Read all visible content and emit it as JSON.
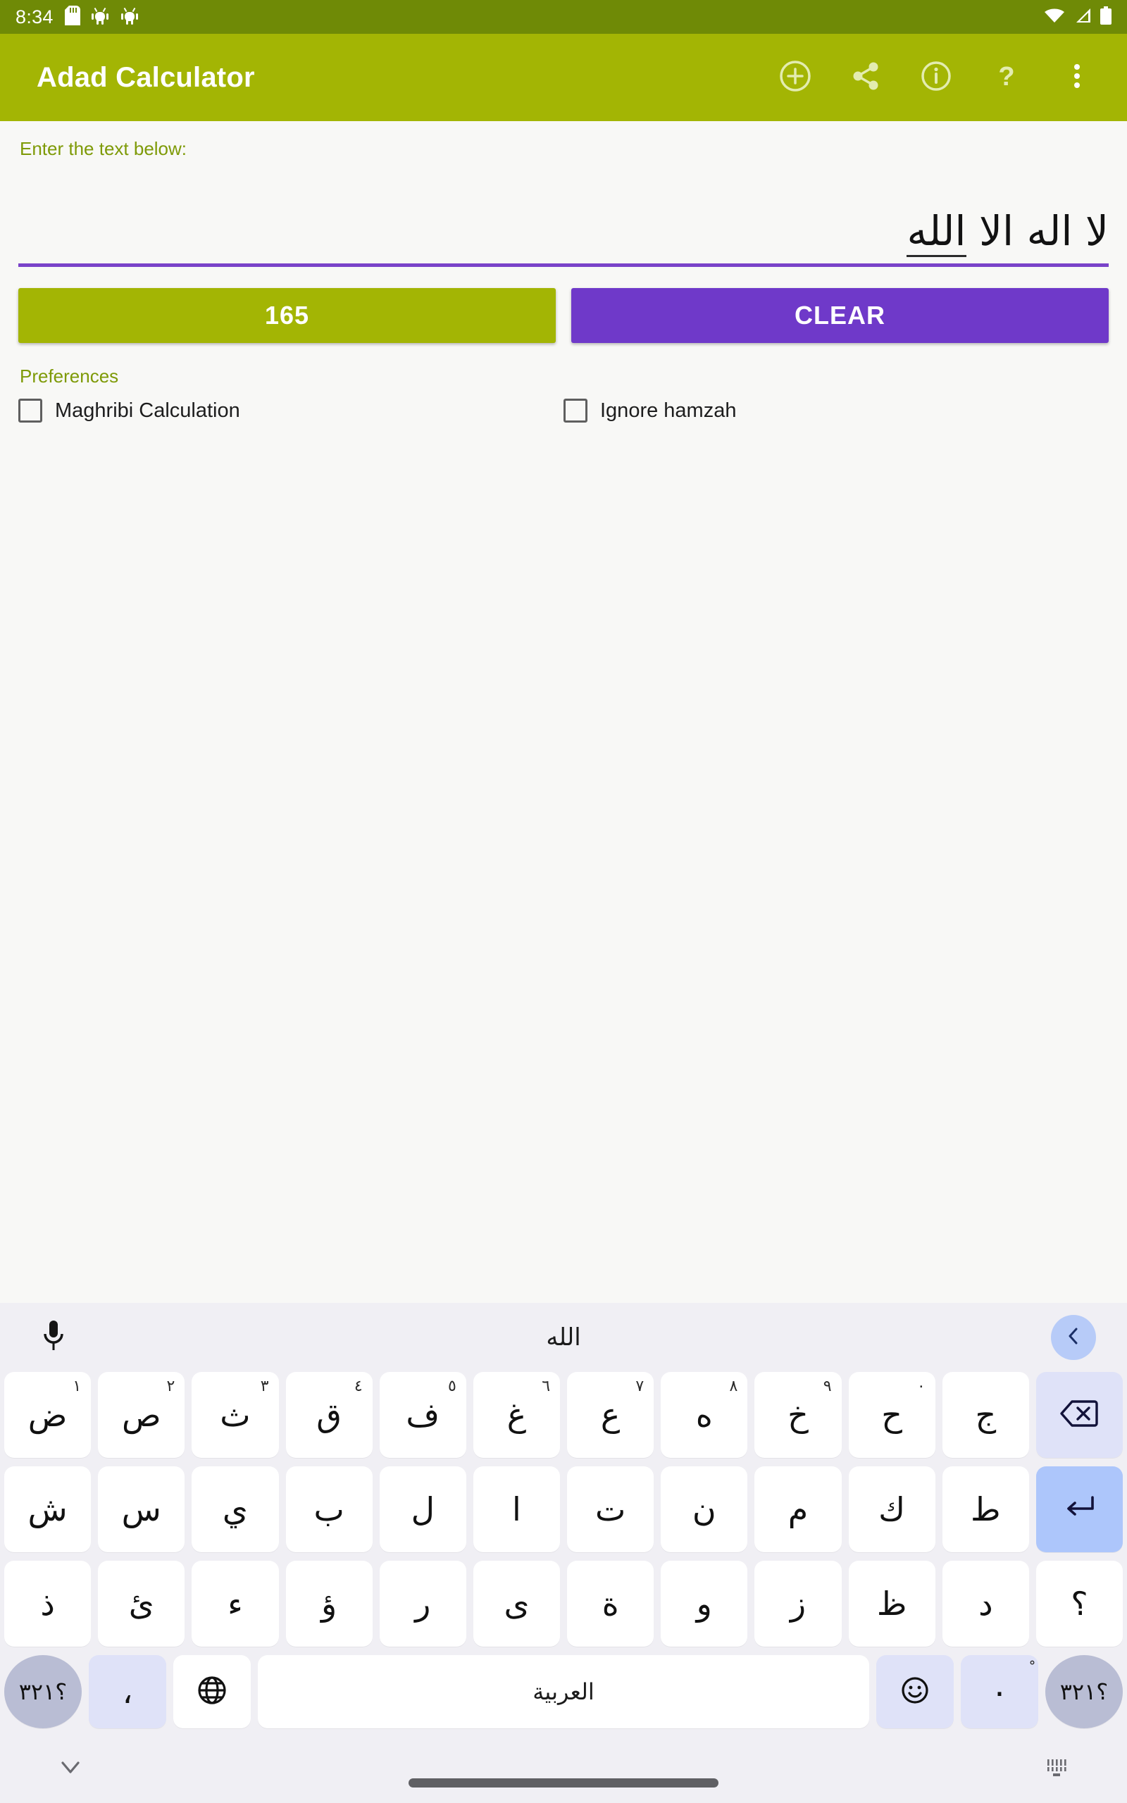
{
  "status_bar": {
    "time": "8:34",
    "left_icons": [
      "sd-card-icon",
      "android-bug-icon",
      "android-bug-icon"
    ],
    "right_icons": [
      "wifi-icon",
      "cellular-signal-icon",
      "battery-full-icon"
    ],
    "background_color": "#6f8a06"
  },
  "app_bar": {
    "title": "Adad Calculator",
    "background_color": "#a3b504",
    "actions": [
      {
        "name": "add-circle-icon",
        "label": "Add"
      },
      {
        "name": "share-icon",
        "label": "Share"
      },
      {
        "name": "info-circle-icon",
        "label": "Info"
      },
      {
        "name": "help-question-icon",
        "label": "Help"
      },
      {
        "name": "overflow-menu-icon",
        "label": "More options"
      }
    ]
  },
  "main": {
    "field_label": "Enter the text below:",
    "input": {
      "value": "لا اله الا ",
      "composing_value": "الله",
      "placeholder": "",
      "underline_color": "#7a43c9"
    },
    "buttons": {
      "result_label": "165",
      "result_color": "#a3b504",
      "clear_label": "CLEAR",
      "clear_color": "#6f39c9"
    },
    "preferences": {
      "heading": "Preferences",
      "items": [
        {
          "label": "Maghribi Calculation",
          "checked": false
        },
        {
          "label": "Ignore hamzah",
          "checked": false
        }
      ]
    }
  },
  "keyboard": {
    "suggestion_bar": {
      "mic_icon": "microphone-icon",
      "suggestion": "الله",
      "expand_icon": "chevron-left-icon"
    },
    "rows": [
      [
        {
          "glyph": "ض",
          "sup": "١"
        },
        {
          "glyph": "ص",
          "sup": "٢"
        },
        {
          "glyph": "ث",
          "sup": "٣"
        },
        {
          "glyph": "ق",
          "sup": "٤"
        },
        {
          "glyph": "ف",
          "sup": "٥"
        },
        {
          "glyph": "غ",
          "sup": "٦"
        },
        {
          "glyph": "ع",
          "sup": "٧"
        },
        {
          "glyph": "ه",
          "sup": "٨"
        },
        {
          "glyph": "خ",
          "sup": "٩"
        },
        {
          "glyph": "ح",
          "sup": "٠"
        },
        {
          "glyph": "ج",
          "sup": ""
        },
        {
          "glyph": "",
          "sup": "",
          "icon": "backspace-icon",
          "style": "fn-light",
          "name": "key-backspace"
        }
      ],
      [
        {
          "glyph": "ش",
          "sup": ""
        },
        {
          "glyph": "س",
          "sup": ""
        },
        {
          "glyph": "ي",
          "sup": ""
        },
        {
          "glyph": "ب",
          "sup": ""
        },
        {
          "glyph": "ل",
          "sup": ""
        },
        {
          "glyph": "ا",
          "sup": ""
        },
        {
          "glyph": "ت",
          "sup": ""
        },
        {
          "glyph": "ن",
          "sup": ""
        },
        {
          "glyph": "م",
          "sup": ""
        },
        {
          "glyph": "ك",
          "sup": ""
        },
        {
          "glyph": "ط",
          "sup": ""
        },
        {
          "glyph": "",
          "sup": "",
          "icon": "enter-return-icon",
          "style": "fn-enter",
          "name": "key-enter"
        }
      ],
      [
        {
          "glyph": "ذ",
          "sup": ""
        },
        {
          "glyph": "ئ",
          "sup": ""
        },
        {
          "glyph": "ء",
          "sup": ""
        },
        {
          "glyph": "ؤ",
          "sup": ""
        },
        {
          "glyph": "ر",
          "sup": ""
        },
        {
          "glyph": "ى",
          "sup": ""
        },
        {
          "glyph": "ة",
          "sup": ""
        },
        {
          "glyph": "و",
          "sup": ""
        },
        {
          "glyph": "ز",
          "sup": ""
        },
        {
          "glyph": "ظ",
          "sup": ""
        },
        {
          "glyph": "د",
          "sup": ""
        },
        {
          "glyph": "؟",
          "sup": ""
        }
      ]
    ],
    "bottom_row": {
      "symbols_left_label": "؟٣٢١",
      "comma_label": "،",
      "globe_icon": "language-globe-icon",
      "space_label": "العربية",
      "emoji_icon": "emoji-smiley-icon",
      "period_label": "٠",
      "period_sup": "ْ",
      "symbols_right_label": "؟٣٢١"
    }
  },
  "nav_bar": {
    "hide_keyboard_icon": "chevron-down-icon",
    "home_pill": "home-gesture-pill",
    "switch_keyboard_icon": "keyboard-switch-icon"
  }
}
